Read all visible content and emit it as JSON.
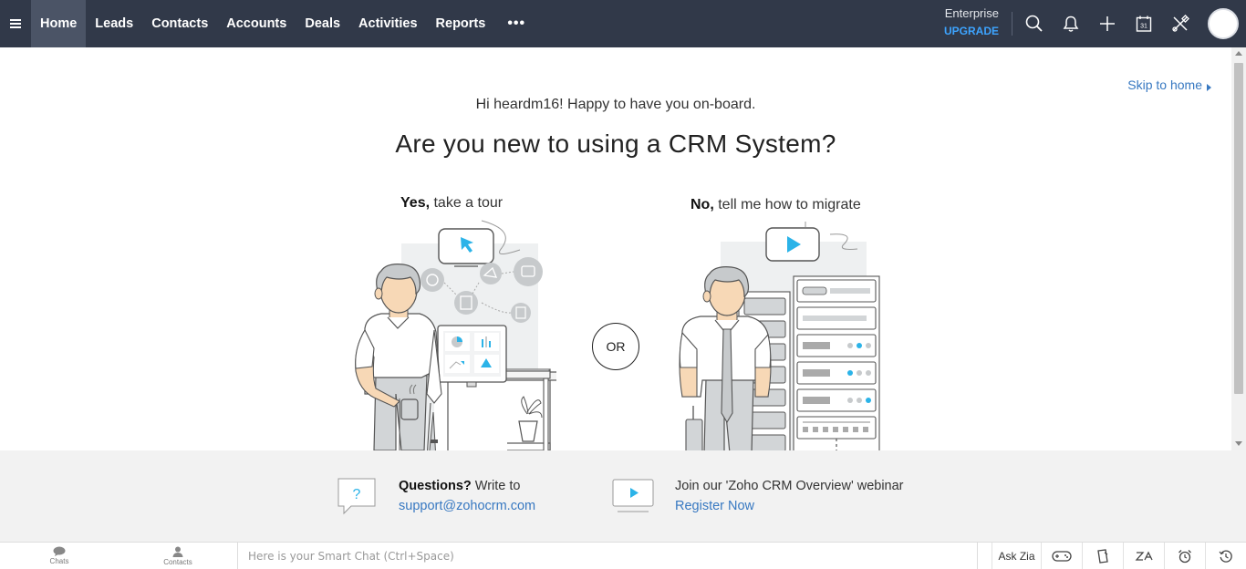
{
  "nav": {
    "items": [
      {
        "label": "Home",
        "active": true
      },
      {
        "label": "Leads"
      },
      {
        "label": "Contacts"
      },
      {
        "label": "Accounts"
      },
      {
        "label": "Deals"
      },
      {
        "label": "Activities"
      },
      {
        "label": "Reports"
      }
    ],
    "more": "•••",
    "edition": "Enterprise",
    "upgrade": "UPGRADE",
    "calendar_day": "31"
  },
  "main": {
    "skip": "Skip to home",
    "greeting": "Hi heardm16! Happy to have you on-board.",
    "headline": "Are you new to using a CRM System?",
    "option_yes": {
      "bold": "Yes,",
      "text": " take a tour"
    },
    "option_no": {
      "bold": "No,",
      "text": " tell me how to migrate"
    },
    "or": "OR"
  },
  "help": {
    "questions_bold": "Questions?",
    "questions_text": " Write to",
    "email": "support@zohocrm.com",
    "webinar_text": "Join our 'Zoho CRM Overview' webinar",
    "register": "Register Now",
    "question_mark": "?"
  },
  "bottom": {
    "chats": "Chats",
    "contacts": "Contacts",
    "smartchat_placeholder": "Here is your Smart Chat (Ctrl+Space)",
    "ask_zia": "Ask Zia"
  },
  "colors": {
    "topbar": "#313949",
    "accent": "#3da4ff",
    "link": "#3778c1",
    "illustration_accent": "#2bb3e8"
  }
}
